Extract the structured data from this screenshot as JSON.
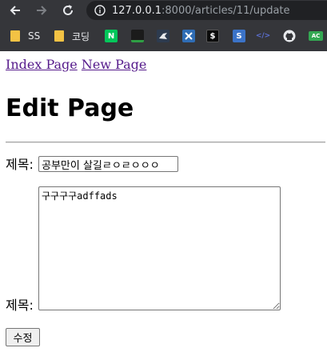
{
  "browser": {
    "url_host": "127.0.0.1",
    "url_rest": ":8000/articles/11/update",
    "bookmarks": [
      {
        "label": "SS",
        "icon": "folder-icon"
      },
      {
        "label": "코딩",
        "icon": "folder-icon"
      },
      {
        "label": "N",
        "icon": "naver-icon",
        "color": "#03c75a"
      },
      {
        "label": "",
        "icon": "green-bar-icon",
        "color": "#2e7d32"
      },
      {
        "label": "",
        "icon": "bird-icon",
        "color": "#2d4a6b"
      },
      {
        "label": "",
        "icon": "x-box-icon",
        "color": "#2f6db5"
      },
      {
        "label": "$",
        "icon": "terminal-icon",
        "color": "#111111"
      },
      {
        "label": "S",
        "icon": "s-icon",
        "color": "#3b73c8"
      },
      {
        "label": "</>",
        "icon": "code-icon",
        "color": "#5b6fd1"
      },
      {
        "label": "",
        "icon": "github-icon",
        "color": "#e8eaed"
      },
      {
        "label": "AC",
        "icon": "ac-icon",
        "color": "#34a853"
      }
    ]
  },
  "nav": {
    "index_link": "Index Page",
    "new_link": "New Page"
  },
  "page": {
    "heading": "Edit Page"
  },
  "form": {
    "title_label": "제목:",
    "title_value": "공부만이 살길ㄹㅇㄹㅇㅇㅇ",
    "content_label": "제목:",
    "content_value": "구구구구adffads",
    "submit_label": "수정"
  }
}
